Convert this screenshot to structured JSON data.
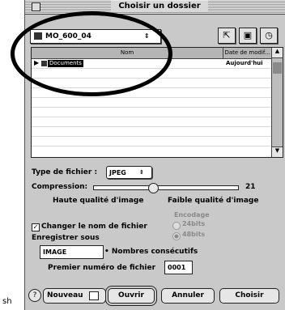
{
  "window": {
    "title": "Choisir un dossier"
  },
  "toolbar": {
    "folder_popup_value": "MO_600_04"
  },
  "list": {
    "col_name": "Nom",
    "col_date": "Date de modif...",
    "items": [
      {
        "name": "Documents",
        "date": "Aujourd'hui"
      }
    ]
  },
  "options": {
    "type_label": "Type de fichier :",
    "type_value": "JPEG",
    "compression_label": "Compression:",
    "compression_value": "21",
    "compression_level": 0.4,
    "high_quality": "Haute qualité d'image",
    "low_quality": "Faible qualité d'image",
    "encoding_label": "Encodage",
    "enc_24": "24bits",
    "enc_48": "48bits",
    "rename_label": "Changer le nom de fichier",
    "save_as_label": "Enregistrer sous",
    "name_value": "IMAGE",
    "suffix_label": "• Nombres consécutifs",
    "first_num_label": "Premier numéro de fichier",
    "first_num_value": "0001"
  },
  "buttons": {
    "nouveau": "Nouveau",
    "ouvrir": "Ouvrir",
    "annuler": "Annuler",
    "choisir": "Choisir"
  },
  "side_text": "sh"
}
